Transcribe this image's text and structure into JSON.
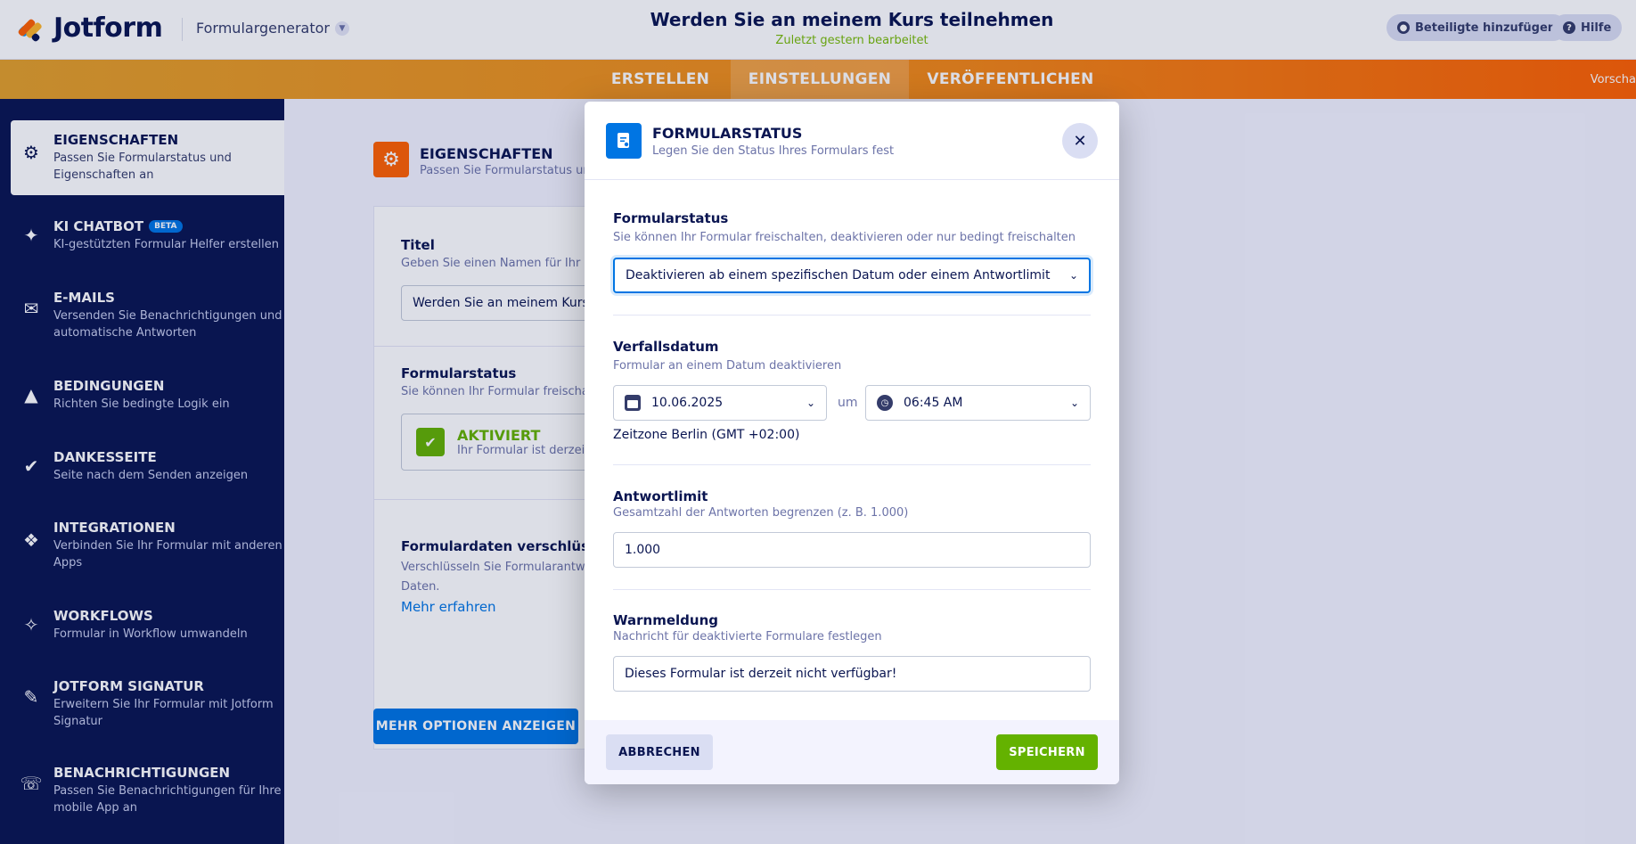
{
  "header": {
    "logo_text": "Jotform",
    "form_builder_label": "Formulargenerator",
    "form_title": "Werden Sie an meinem Kurs teilnehmen",
    "form_subtitle": "Zuletzt gestern bearbeitet",
    "add_participants_label": "Beteiligte hinzufügen",
    "help_label": "Hilfe"
  },
  "nav": {
    "tabs": [
      {
        "label": "ERSTELLEN"
      },
      {
        "label": "EINSTELLUNGEN"
      },
      {
        "label": "VERÖFFENTLICHEN"
      }
    ],
    "preview_label": "Vorscha"
  },
  "sidebar": {
    "items": [
      {
        "title": "EIGENSCHAFTEN",
        "desc": "Passen Sie Formularstatus und Eigenschaften an",
        "icon": "gear-icon"
      },
      {
        "title": "KI CHATBOT",
        "badge": "BETA",
        "desc": "KI-gestützten Formular Helfer erstellen",
        "icon": "chatbot-icon"
      },
      {
        "title": "E-MAILS",
        "desc": "Versenden Sie Benachrichtigungen und automatische Antworten",
        "icon": "envelope-icon"
      },
      {
        "title": "BEDINGUNGEN",
        "desc": "Richten Sie bedingte Logik ein",
        "icon": "hierarchy-icon"
      },
      {
        "title": "DANKESSEITE",
        "desc": "Seite nach dem Senden anzeigen",
        "icon": "check-circle-icon"
      },
      {
        "title": "INTEGRATIONEN",
        "desc": "Verbinden Sie Ihr Formular mit anderen Apps",
        "icon": "puzzle-icon"
      },
      {
        "title": "WORKFLOWS",
        "desc": "Formular in Workflow umwandeln",
        "icon": "workflow-icon"
      },
      {
        "title": "JOTFORM SIGNATUR",
        "desc": "Erweitern Sie Ihr Formular mit Jotform Signatur",
        "icon": "pen-icon"
      },
      {
        "title": "BENACHRICHTIGUNGEN",
        "desc": "Passen Sie Benachrichtigungen für Ihre mobile App an",
        "icon": "mobile-bell-icon"
      }
    ]
  },
  "main": {
    "section_title": "EIGENSCHAFTEN",
    "section_desc": "Passen Sie Formularstatus und",
    "title_label": "Titel",
    "title_desc": "Geben Sie einen Namen für Ihr F",
    "title_value": "Werden Sie an meinem Kurs te",
    "status_label": "Formularstatus",
    "status_desc": "Sie können Ihr Formular freischal",
    "status_value": "AKTIVIERT",
    "status_value_desc": "Ihr Formular ist derzeit",
    "encrypt_label": "Formulardaten verschlüssel",
    "encrypt_desc_1": "Verschlüsseln Sie Formularantwo",
    "encrypt_desc_2": "Daten.",
    "learn_more": "Mehr erfahren",
    "more_options_button": "MEHR OPTIONEN ANZEIGEN"
  },
  "modal": {
    "title": "FORMULARSTATUS",
    "subtitle": "Legen Sie den Status Ihres Formulars fest",
    "status_label": "Formularstatus",
    "status_desc": "Sie können Ihr Formular freischalten, deaktivieren oder nur bedingt freischalten",
    "status_selected": "Deaktivieren ab einem spezifischen Datum oder einem Antwortlimit",
    "expiry_label": "Verfallsdatum",
    "expiry_desc": "Formular an einem Datum deaktivieren",
    "date_value": "10.06.2025",
    "at_label": "um",
    "time_value": "06:45 AM",
    "timezone": "Zeitzone Berlin (GMT +02:00)",
    "limit_label": "Antwortlimit",
    "limit_desc": "Gesamtzahl der Antworten begrenzen (z. B. 1.000)",
    "limit_value": "1.000",
    "warning_label": "Warnmeldung",
    "warning_desc": "Nachricht für deaktivierte Formulare festlegen",
    "warning_value": "Dieses Formular ist derzeit nicht verfügbar!",
    "cancel_button": "ABBRECHEN",
    "save_button": "SPEICHERN"
  },
  "colors": {
    "navy": "#0a1551",
    "orange": "#ff6100",
    "blue": "#0075e3",
    "green": "#64b200"
  }
}
